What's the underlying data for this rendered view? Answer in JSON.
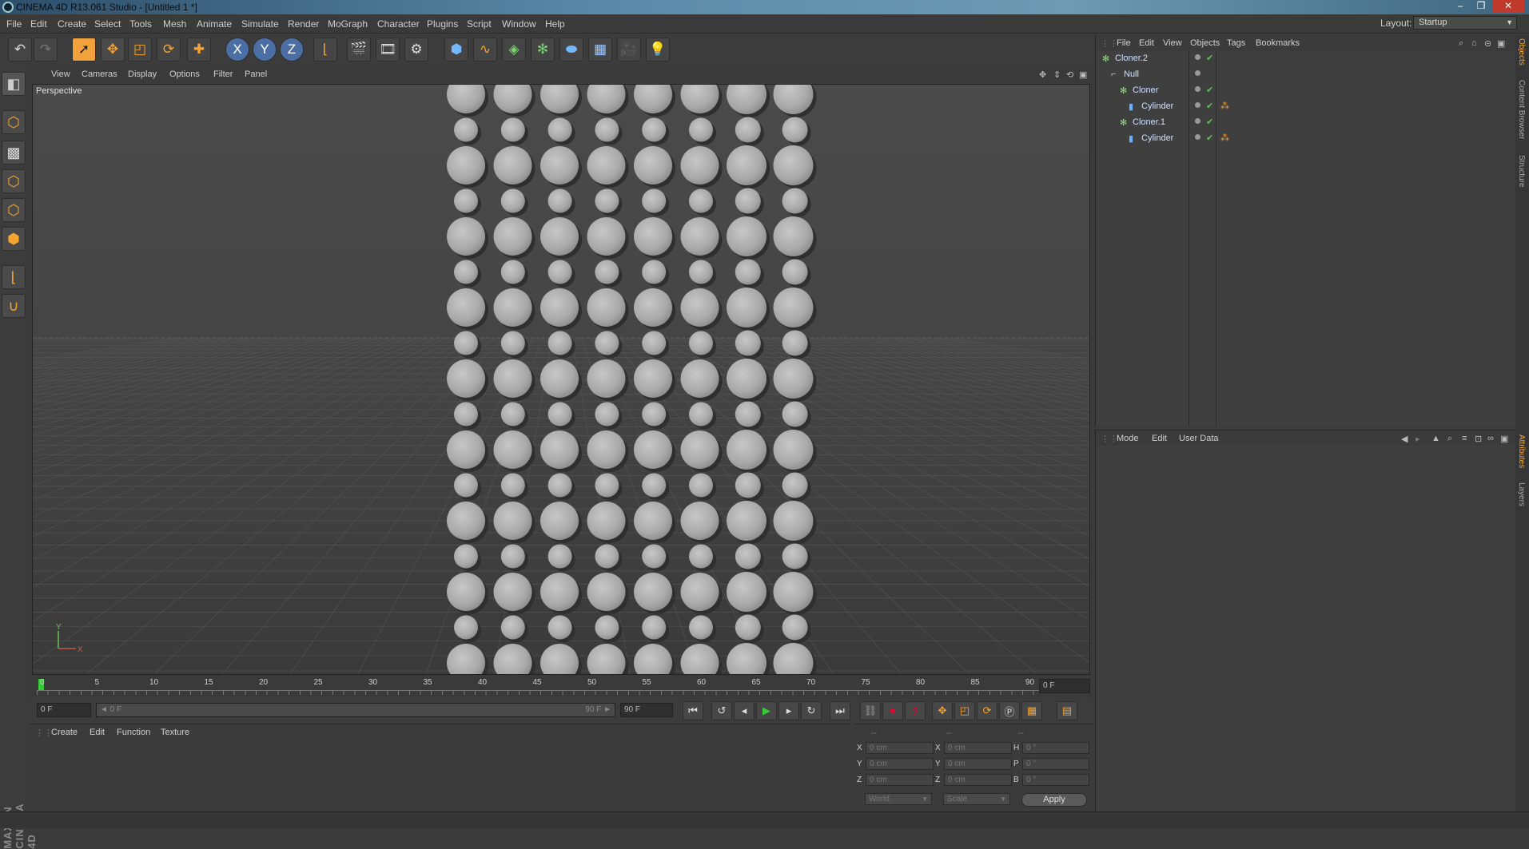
{
  "window": {
    "title": "CINEMA 4D R13.061 Studio - [Untitled 1 *]",
    "controls": [
      "–",
      "❐",
      "✕"
    ]
  },
  "menubar": {
    "items": [
      "File",
      "Edit",
      "Create",
      "Select",
      "Tools",
      "Mesh",
      "Animate",
      "Simulate",
      "Render",
      "MoGraph",
      "Character",
      "Plugins",
      "Script",
      "Window",
      "Help"
    ],
    "layout_label": "Layout:",
    "layout_value": "Startup"
  },
  "toolbar": {
    "icons": [
      "undo-icon",
      "redo-icon",
      "live-selection-icon",
      "move-icon",
      "scale-icon",
      "rotate-icon",
      "add-object-icon",
      "x-axis-icon",
      "y-axis-icon",
      "z-axis-icon",
      "coordinate-system-icon",
      "render-view-icon",
      "render-picture-viewer-icon",
      "edit-render-settings-icon",
      "cube-icon",
      "spline-icon",
      "nurbs-icon",
      "mograph-cloner-icon",
      "deformer-icon",
      "floor-icon",
      "camera-icon",
      "light-icon"
    ],
    "axis_labels": [
      "X",
      "Y",
      "Z"
    ]
  },
  "left_tools": [
    "model-mode-icon",
    "texture-mode-icon",
    "points-mode-icon",
    "edges-mode-icon",
    "polygons-mode-icon",
    "axis-mode-icon",
    "snap-magnet-icon"
  ],
  "maxon_logo": "MAXON CINEMA 4D",
  "viewport": {
    "menu": [
      "View",
      "Cameras",
      "Display",
      "Options",
      "Filter",
      "Panel"
    ],
    "label": "Perspective",
    "axis_labels": {
      "x": "X",
      "y": "Y"
    }
  },
  "timeline": {
    "ticks": [
      "0",
      "5",
      "10",
      "15",
      "20",
      "25",
      "30",
      "35",
      "40",
      "45",
      "50",
      "55",
      "60",
      "65",
      "70",
      "75",
      "80",
      "85",
      "90"
    ],
    "current_frame": "0 F"
  },
  "transport": {
    "start_field": "0 F",
    "range_start": "◄ 0 F",
    "range_end": "90 F ►",
    "end_field": "90 F"
  },
  "material_manager": {
    "menu": [
      "Create",
      "Edit",
      "Function",
      "Texture"
    ]
  },
  "coordinates": {
    "headers": [
      "--",
      "--",
      "--"
    ],
    "rows": [
      {
        "l1": "X",
        "v1": "0 cm",
        "l2": "X",
        "v2": "0 cm",
        "l3": "H",
        "v3": "0 °"
      },
      {
        "l1": "Y",
        "v1": "0 cm",
        "l2": "Y",
        "v2": "0 cm",
        "l3": "P",
        "v3": "0 °"
      },
      {
        "l1": "Z",
        "v1": "0 cm",
        "l2": "Z",
        "v2": "0 cm",
        "l3": "B",
        "v3": "0 °"
      }
    ],
    "world_select": "World",
    "scale_select": "Scale",
    "apply_label": "Apply"
  },
  "object_manager": {
    "menu": [
      "File",
      "Edit",
      "View",
      "Objects",
      "Tags",
      "Bookmarks"
    ],
    "objects": [
      {
        "name": "Cloner.2",
        "indent": 0,
        "icon": "cloner-icon"
      },
      {
        "name": "Null",
        "indent": 1,
        "icon": "null-icon"
      },
      {
        "name": "Cloner",
        "indent": 2,
        "icon": "cloner-icon"
      },
      {
        "name": "Cylinder",
        "indent": 3,
        "icon": "cylinder-icon"
      },
      {
        "name": "Cloner.1",
        "indent": 2,
        "icon": "cloner-icon"
      },
      {
        "name": "Cylinder",
        "indent": 3,
        "icon": "cylinder-icon"
      }
    ]
  },
  "attributes": {
    "menu": [
      "Mode",
      "Edit",
      "User Data"
    ]
  },
  "right_tabs": [
    "Objects",
    "Content Browser",
    "Structure",
    "Attributes",
    "Layers"
  ]
}
